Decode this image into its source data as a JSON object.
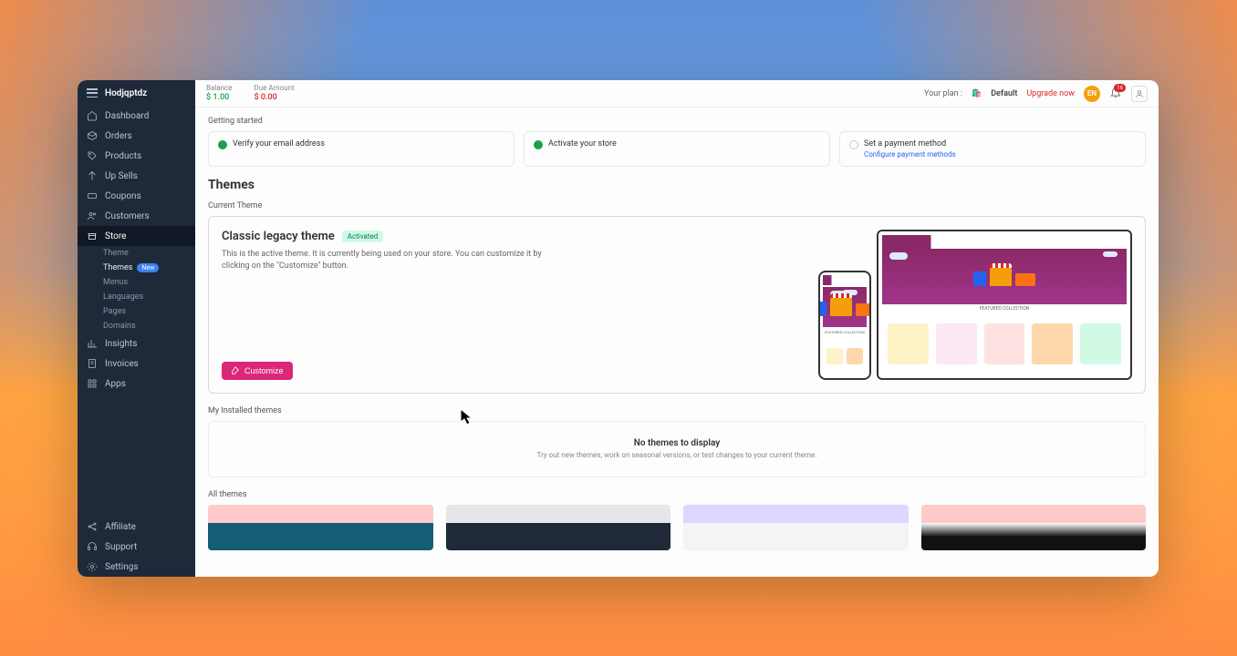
{
  "brand": "Hodjqptdz",
  "sidebar": {
    "items": [
      {
        "label": "Dashboard"
      },
      {
        "label": "Orders"
      },
      {
        "label": "Products"
      },
      {
        "label": "Up Sells"
      },
      {
        "label": "Coupons"
      },
      {
        "label": "Customers"
      },
      {
        "label": "Store"
      },
      {
        "label": "Insights"
      },
      {
        "label": "Invoices"
      },
      {
        "label": "Apps"
      }
    ],
    "store_sub": [
      {
        "label": "Theme"
      },
      {
        "label": "Themes",
        "badge": "New"
      },
      {
        "label": "Menus"
      },
      {
        "label": "Languages"
      },
      {
        "label": "Pages"
      },
      {
        "label": "Domains"
      }
    ],
    "bottom": [
      {
        "label": "Affiliate"
      },
      {
        "label": "Support"
      },
      {
        "label": "Settings"
      }
    ]
  },
  "topbar": {
    "balance_label": "Balance",
    "balance_value": "$ 1.00",
    "due_label": "Due Amount",
    "due_value": "$ 0.00",
    "plan_prefix": "Your plan :",
    "plan_name": "Default",
    "upgrade": "Upgrade now",
    "avatar": "EN",
    "bell_count": "16"
  },
  "getting_started": {
    "heading": "Getting started",
    "cards": [
      {
        "title": "Verify your email address",
        "done": true
      },
      {
        "title": "Activate your store",
        "done": true
      },
      {
        "title": "Set a payment method",
        "done": false,
        "link": "Configure payment methods"
      }
    ]
  },
  "page": {
    "title": "Themes",
    "current_label": "Current Theme",
    "theme": {
      "name": "Classic legacy theme",
      "badge": "Activated",
      "desc": "This is the active theme. It is currently being used on your store. You can customize it by clicking on the \"Customize\" button.",
      "customize": "Customize",
      "featured_text": "FEATURED COLLECTION"
    },
    "installed_label": "My Installed themes",
    "empty": {
      "title": "No themes to display",
      "sub": "Try out new themes, work on seasonal versions, or test changes to your current theme."
    },
    "all_label": "All themes"
  }
}
